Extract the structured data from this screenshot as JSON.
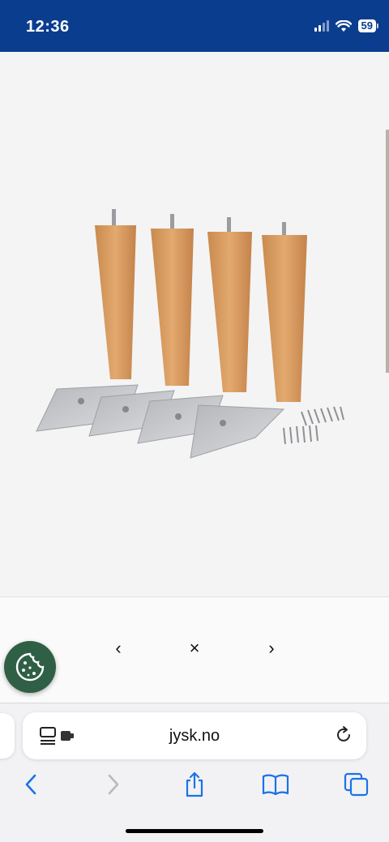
{
  "status_bar": {
    "time": "12:36",
    "battery_level": "59",
    "signal_icon": "cellular-signal-icon",
    "wifi_icon": "wifi-icon"
  },
  "product": {
    "image_icon": "furniture-legs-product-photo",
    "colors": {
      "wood": "#d79a5e",
      "metal": "#c2c4c8",
      "accent": "#0b3d8f"
    }
  },
  "gallery": {
    "prev_symbol": "‹",
    "close_symbol": "×",
    "next_symbol": "›"
  },
  "cookie_button": {
    "icon": "cookie-icon",
    "color": "#2f5f45"
  },
  "browser": {
    "url": "jysk.no",
    "page_menu_icon": "page-menu-icon",
    "reload_icon": "reload-icon",
    "toolbar": {
      "back_icon": "chevron-left-icon",
      "forward_icon": "chevron-right-icon",
      "share_icon": "share-icon",
      "bookmarks_icon": "book-icon",
      "tabs_icon": "tabs-icon"
    }
  }
}
